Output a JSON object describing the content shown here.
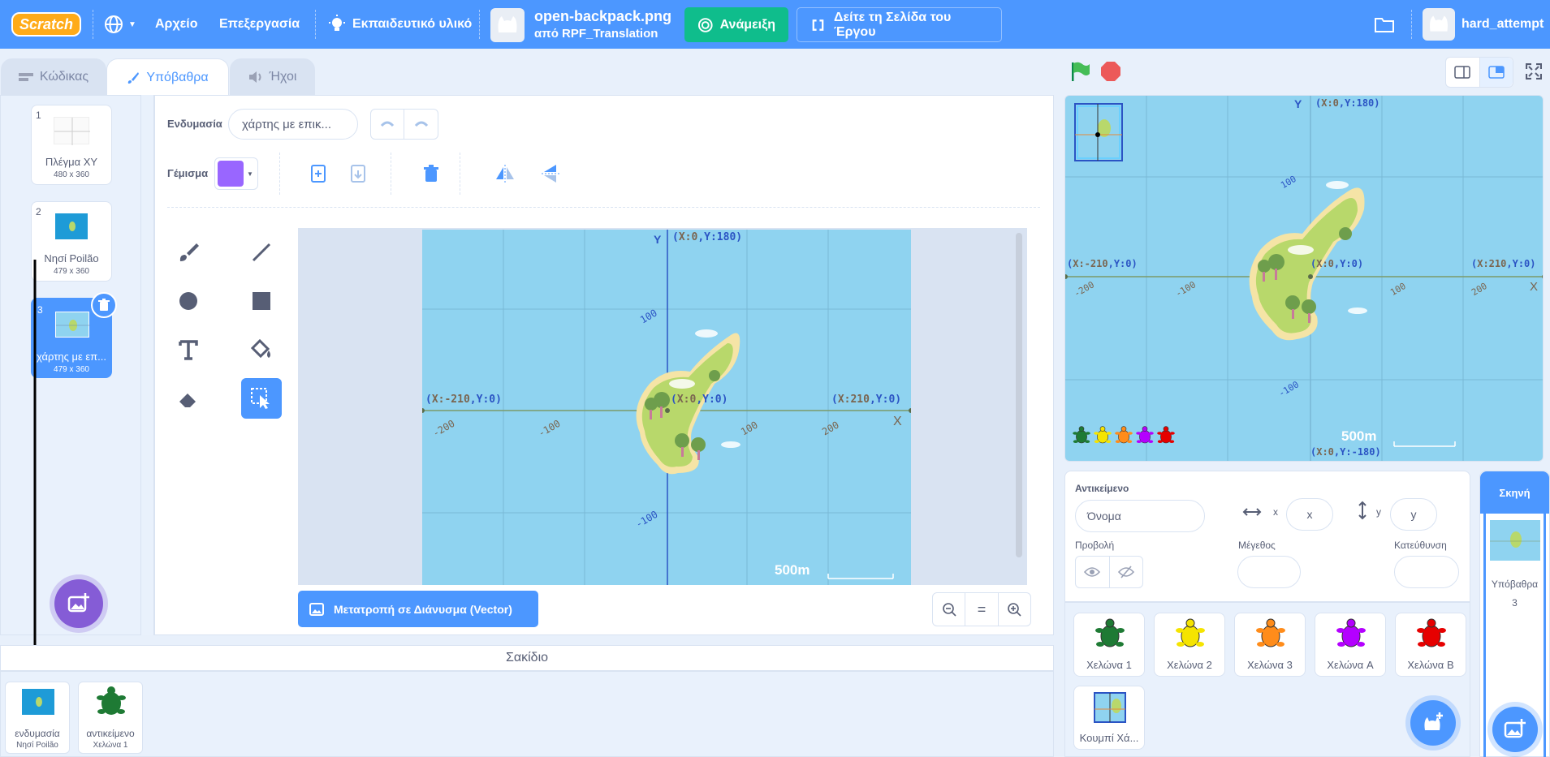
{
  "menu": {
    "logo": "Scratch",
    "file": "Αρχείο",
    "edit": "Επεξεργασία",
    "tutorials": "Εκπαιδευτικό υλικό",
    "project_title": "open-backpack.png",
    "project_author": "από RPF_Translation",
    "remix": "Ανάμειξη",
    "see_project": "Δείτε τη Σελίδα του Έργου",
    "username": "hard_attempt"
  },
  "tabs": {
    "code": "Κώδικας",
    "costumes": "Υπόβαθρα",
    "sounds": "Ήχοι"
  },
  "costumes": [
    {
      "num": "1",
      "name": "Πλέγμα XY",
      "size": "480 x 360"
    },
    {
      "num": "2",
      "name": "Νησί Poilão",
      "size": "479 x 360"
    },
    {
      "num": "3",
      "name": "χάρτης με επ...",
      "size": "479 x 360"
    }
  ],
  "editor": {
    "costume_label": "Ενδυμασία",
    "costume_name": "χάρτης με επικ...",
    "fill_label": "Γέμισμα",
    "fill_color": "#9966ff",
    "convert_button": "Μετατροπή σε Διάνυσμα (Vector)",
    "zoom_reset": "="
  },
  "map": {
    "y_axis": "Y",
    "x_axis": "X",
    "top_xlbl": "X:0",
    "top_ylbl": "Y:180",
    "left_xlbl": "X:-210",
    "left_ylbl": "Y:0",
    "center_xlbl": "X:0",
    "center_ylbl": "Y:0",
    "right_xlbl": "X:210",
    "right_ylbl": "Y:0",
    "bottom_xlbl": "X:0",
    "bottom_ylbl": "Y:-180",
    "tick_n200": "-200",
    "tick_n100": "-100",
    "tick_100": "100",
    "tick_200": "200",
    "scale": "500m"
  },
  "sprite_info": {
    "sprite_label": "Αντικείμενο",
    "name_placeholder": "Όνομα",
    "x_label": "x",
    "x_placeholder": "x",
    "y_label": "y",
    "y_placeholder": "y",
    "show_label": "Προβολή",
    "size_label": "Μέγεθος",
    "direction_label": "Κατεύθυνση"
  },
  "sprites": [
    {
      "name": "Χελώνα 1",
      "color": "#1e7a34"
    },
    {
      "name": "Χελώνα 2",
      "color": "#f5e400"
    },
    {
      "name": "Χελώνα 3",
      "color": "#ff8c1a"
    },
    {
      "name": "Χελώνα A",
      "color": "#b400ff"
    },
    {
      "name": "Χελώνα B",
      "color": "#e60000"
    },
    {
      "name": "Κουμπί Χά...",
      "color": "#8fd3f0"
    }
  ],
  "stage_panel": {
    "title": "Σκηνή",
    "backdrops_label": "Υπόβαθρα",
    "backdrops_count": "3"
  },
  "backpack": {
    "title": "Σακίδιο",
    "items": [
      {
        "type": "ενδυμασία",
        "name": "Νησί Poilão"
      },
      {
        "type": "αντικείμενο",
        "name": "Χελώνα 1"
      }
    ]
  }
}
